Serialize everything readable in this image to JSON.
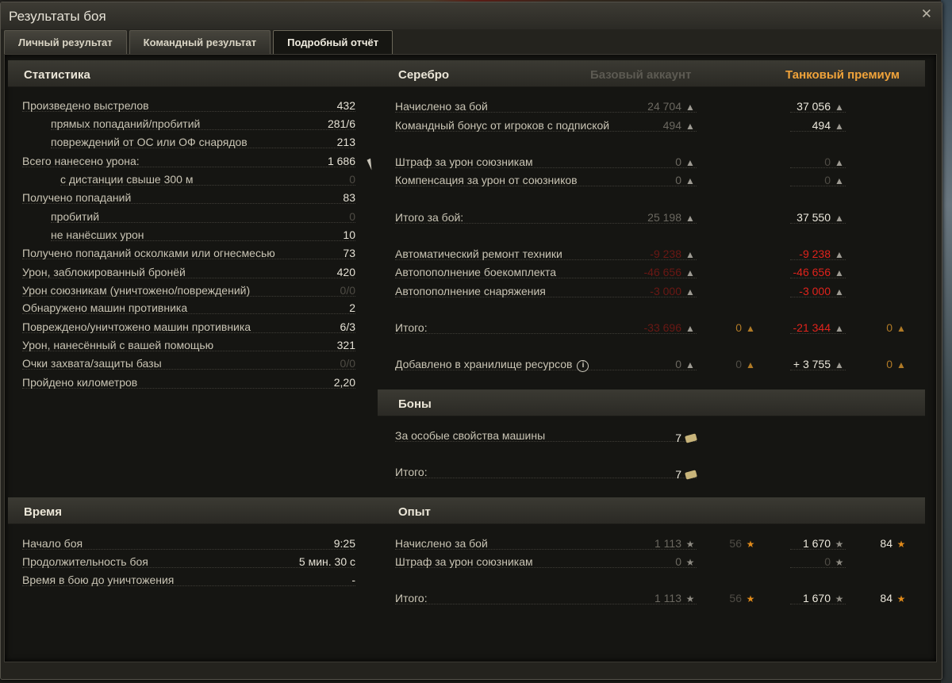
{
  "window": {
    "title": "Результаты боя",
    "close": "✕"
  },
  "tabs": [
    "Личный результат",
    "Командный результат",
    "Подробный отчёт"
  ],
  "stats": {
    "title": "Статистика",
    "rows": [
      {
        "label": "Произведено выстрелов",
        "value": "432"
      },
      {
        "label": "прямых попаданий/пробитий",
        "value": "281/6"
      },
      {
        "label": "повреждений от ОС или ОФ снарядов",
        "value": "213"
      },
      {
        "label": "Всего нанесено урона:",
        "value": "1 686"
      },
      {
        "label": "с дистанции свыше 300 м",
        "value": "0"
      },
      {
        "label": "Получено попаданий",
        "value": "83"
      },
      {
        "label": "пробитий",
        "value": "0"
      },
      {
        "label": "не нанёсших урон",
        "value": "10"
      },
      {
        "label": "Получено попаданий осколками или огнесмесью",
        "value": "73"
      },
      {
        "label": "Урон, заблокированный бронёй",
        "value": "420"
      },
      {
        "label": "Урон союзникам (уничтожено/повреждений)",
        "value": "0/0"
      },
      {
        "label": "Обнаружено машин противника",
        "value": "2"
      },
      {
        "label": "Повреждено/уничтожено машин противника",
        "value": "6/3"
      },
      {
        "label": "Урон, нанесённый с вашей помощью",
        "value": "321"
      },
      {
        "label": "Очки захвата/защиты базы",
        "value": "0/0"
      },
      {
        "label": "Пройдено километров",
        "value": "2,20"
      }
    ]
  },
  "time": {
    "title": "Время",
    "rows": [
      {
        "label": "Начало боя",
        "value": "9:25"
      },
      {
        "label": "Продолжительность боя",
        "value": "5 мин. 30 с"
      },
      {
        "label": "Время в бою до уничтожения",
        "value": "-"
      }
    ]
  },
  "silver": {
    "title": "Серебро",
    "col_basic": "Базовый аккаунт",
    "col_premium": "Танковый премиум",
    "rows": [
      {
        "label": "Начислено за бой",
        "basic": "24 704",
        "premium": "37 056"
      },
      {
        "label": "Командный бонус от игроков с подпиской",
        "basic": "494",
        "premium": "494"
      },
      {
        "label": "Штраф за урон союзникам",
        "basic": "0",
        "premium": "0"
      },
      {
        "label": "Компенсация за урон от союзников",
        "basic": "0",
        "premium": "0"
      },
      {
        "label": "Итого за бой:",
        "basic": "25 198",
        "premium": "37 550"
      },
      {
        "label": "Автоматический ремонт техники",
        "basic": "-9 238",
        "premium": "-9 238"
      },
      {
        "label": "Автопополнение боекомплекта",
        "basic": "-46 656",
        "premium": "-46 656"
      },
      {
        "label": "Автопополнение снаряжения",
        "basic": "-3 000",
        "premium": "-3 000"
      },
      {
        "label": "Итого:",
        "basic": "-33 696",
        "basic_gold": "0",
        "premium": "-21 344",
        "premium_gold": "0"
      },
      {
        "label": "Добавлено в хранилище ресурсов",
        "basic": "0",
        "basic_gold": "0",
        "premium": "+ 3 755",
        "premium_gold": "0"
      }
    ]
  },
  "bonds": {
    "title": "Боны",
    "rows": [
      {
        "label": "За особые свойства машины",
        "value": "7"
      },
      {
        "label": "Итого:",
        "value": "7"
      }
    ]
  },
  "xp": {
    "title": "Опыт",
    "rows": [
      {
        "label": "Начислено за бой",
        "basic": "1 113",
        "basic_free": "56",
        "premium": "1 670",
        "premium_free": "84"
      },
      {
        "label": "Штраф за урон союзникам",
        "basic": "0",
        "premium": "0"
      },
      {
        "label": "Итого:",
        "basic": "1 113",
        "basic_free": "56",
        "premium": "1 670",
        "premium_free": "84"
      }
    ]
  },
  "icons": {
    "silver": "silver-coin-icon",
    "gold": "gold-coin-icon",
    "xp": "xp-star-icon",
    "free_xp": "free-xp-star-icon",
    "info": "info-icon",
    "bond": "bond-icon"
  },
  "colors": {
    "premium_header": "#f0a33a",
    "negative": "#e0231c",
    "background": "#151512"
  }
}
